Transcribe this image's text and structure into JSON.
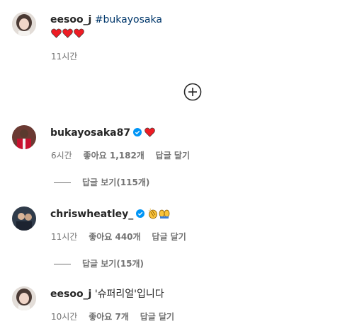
{
  "caption": {
    "username": "eesoo_j",
    "hashtag": "#bukayosaka",
    "emojis": [
      "heart-red",
      "heart-red",
      "heart-red"
    ],
    "time": "11시간"
  },
  "load_more": {
    "icon": "circle-plus-icon"
  },
  "comments": [
    {
      "username": "bukayosaka87",
      "verified": true,
      "emojis": [
        "heart-red"
      ],
      "time": "6시간",
      "likes": "좋아요 1,182개",
      "reply_label": "답글 달기",
      "view_replies": "답글 보기(115개)"
    },
    {
      "username": "chriswheatley_",
      "verified": true,
      "emojis": [
        "clapping-hands",
        "raising-hands"
      ],
      "time": "11시간",
      "likes": "좋아요 440개",
      "reply_label": "답글 달기",
      "view_replies": "답글 보기(15개)"
    },
    {
      "username": "eesoo_j",
      "verified": false,
      "text": "'슈퍼리얼'입니다",
      "time": "10시간",
      "likes": "좋아요 7개",
      "reply_label": "답글 달기"
    }
  ],
  "colors": {
    "heart": "#ed4956",
    "verified": "#0095f6",
    "hashtag": "#00376b",
    "meta": "#737373"
  }
}
